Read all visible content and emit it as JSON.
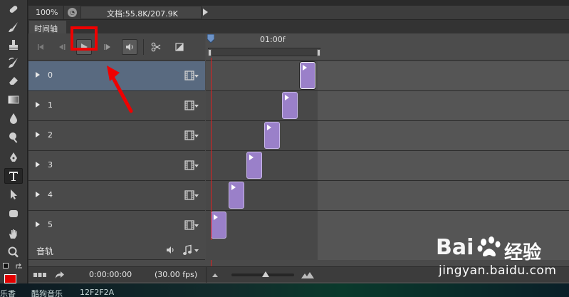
{
  "statusbar": {
    "zoom": "100%",
    "doc_size": "文档:55.8K/207.9K"
  },
  "panel": {
    "tab_label": "时间轴",
    "ruler_label": "01:00f"
  },
  "layers": [
    {
      "label": "0",
      "selected": true
    },
    {
      "label": "1",
      "selected": false
    },
    {
      "label": "2",
      "selected": false
    },
    {
      "label": "3",
      "selected": false
    },
    {
      "label": "4",
      "selected": false
    },
    {
      "label": "5",
      "selected": false
    }
  ],
  "audio_track": {
    "label": "音轨"
  },
  "bottombar": {
    "timecode": "0:00:00:00",
    "fps": "(30.00 fps)",
    "zoom_level": 0.55
  },
  "desktop_strip": {
    "text_1": "乐香",
    "text_2": "酷狗音乐",
    "text_3": "12F2F2A"
  },
  "watermark": {
    "logo": "Bai",
    "brand_cn": "经验",
    "url": "jingyan.baidu.com"
  },
  "colors": {
    "clip": "#9a80c9",
    "playhead": "#e02020",
    "highlight": "#f00000",
    "selected_row": "#596a80",
    "foreground_swatch": "#e00000"
  }
}
